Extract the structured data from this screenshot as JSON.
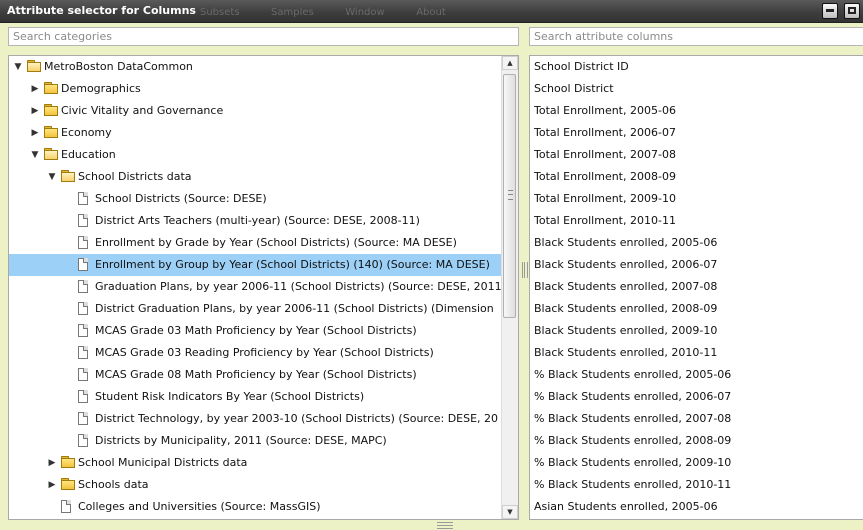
{
  "window": {
    "title": "Attribute selector for Columns",
    "ghost_menu": [
      "Subsets",
      "Samples",
      "Window",
      "About"
    ]
  },
  "search": {
    "categories_placeholder": "Search categories",
    "attributes_placeholder": "Search attribute columns"
  },
  "tree": [
    {
      "depth": 0,
      "kind": "folder",
      "expanded": true,
      "label": "MetroBoston DataCommon"
    },
    {
      "depth": 1,
      "kind": "folder",
      "expanded": false,
      "label": "Demographics"
    },
    {
      "depth": 1,
      "kind": "folder",
      "expanded": false,
      "label": "Civic Vitality and Governance"
    },
    {
      "depth": 1,
      "kind": "folder",
      "expanded": false,
      "label": "Economy"
    },
    {
      "depth": 1,
      "kind": "folder",
      "expanded": true,
      "label": "Education"
    },
    {
      "depth": 2,
      "kind": "folder",
      "expanded": true,
      "label": "School Districts data"
    },
    {
      "depth": 3,
      "kind": "doc",
      "label": "School Districts (Source: DESE)"
    },
    {
      "depth": 3,
      "kind": "doc",
      "label": "District Arts Teachers (multi-year) (Source: DESE, 2008-11)"
    },
    {
      "depth": 3,
      "kind": "doc",
      "label": "Enrollment by Grade by Year (School Districts) (Source: MA DESE)"
    },
    {
      "depth": 3,
      "kind": "doc",
      "selected": true,
      "label": "Enrollment by Group by Year (School Districts) (140) (Source: MA DESE)"
    },
    {
      "depth": 3,
      "kind": "doc",
      "label": "Graduation Plans, by year 2006-11 (School Districts) (Source: DESE, 2011)"
    },
    {
      "depth": 3,
      "kind": "doc",
      "label": "District Graduation Plans, by year 2006-11 (School Districts) (Dimension"
    },
    {
      "depth": 3,
      "kind": "doc",
      "label": "MCAS Grade 03 Math Proficiency by Year (School Districts)"
    },
    {
      "depth": 3,
      "kind": "doc",
      "label": "MCAS Grade 03 Reading Proficiency by Year (School Districts)"
    },
    {
      "depth": 3,
      "kind": "doc",
      "label": "MCAS Grade 08 Math Proficiency by Year (School Districts)"
    },
    {
      "depth": 3,
      "kind": "doc",
      "label": "Student Risk Indicators By Year (School Districts)"
    },
    {
      "depth": 3,
      "kind": "doc",
      "label": "District Technology, by year 2003-10 (School Districts) (Source: DESE, 20"
    },
    {
      "depth": 3,
      "kind": "doc",
      "label": "Districts by Municipality, 2011 (Source: DESE, MAPC)"
    },
    {
      "depth": 2,
      "kind": "folder",
      "expanded": false,
      "label": "School Municipal Districts data"
    },
    {
      "depth": 2,
      "kind": "folder",
      "expanded": false,
      "label": "Schools data"
    },
    {
      "depth": 2,
      "kind": "doc",
      "label": "Colleges and Universities (Source: MassGIS)"
    }
  ],
  "attributes": [
    "School District ID",
    "School District",
    "Total Enrollment, 2005-06",
    "Total Enrollment, 2006-07",
    "Total Enrollment, 2007-08",
    "Total Enrollment, 2008-09",
    "Total Enrollment, 2009-10",
    "Total Enrollment, 2010-11",
    "Black Students enrolled, 2005-06",
    "Black Students enrolled, 2006-07",
    "Black Students enrolled, 2007-08",
    "Black Students enrolled, 2008-09",
    "Black Students enrolled, 2009-10",
    "Black Students enrolled, 2010-11",
    "% Black Students enrolled, 2005-06",
    "% Black Students enrolled, 2006-07",
    "% Black Students enrolled, 2007-08",
    "% Black Students enrolled, 2008-09",
    "% Black Students enrolled, 2009-10",
    "% Black Students enrolled, 2010-11",
    "Asian Students enrolled, 2005-06"
  ],
  "scrollbar": {
    "up_glyph": "▲",
    "down_glyph": "▼"
  },
  "icons": {
    "expanded": "▼",
    "collapsed": "▶"
  },
  "colors": {
    "selection": "#9dd0f7",
    "background": "#ecf2c5"
  }
}
